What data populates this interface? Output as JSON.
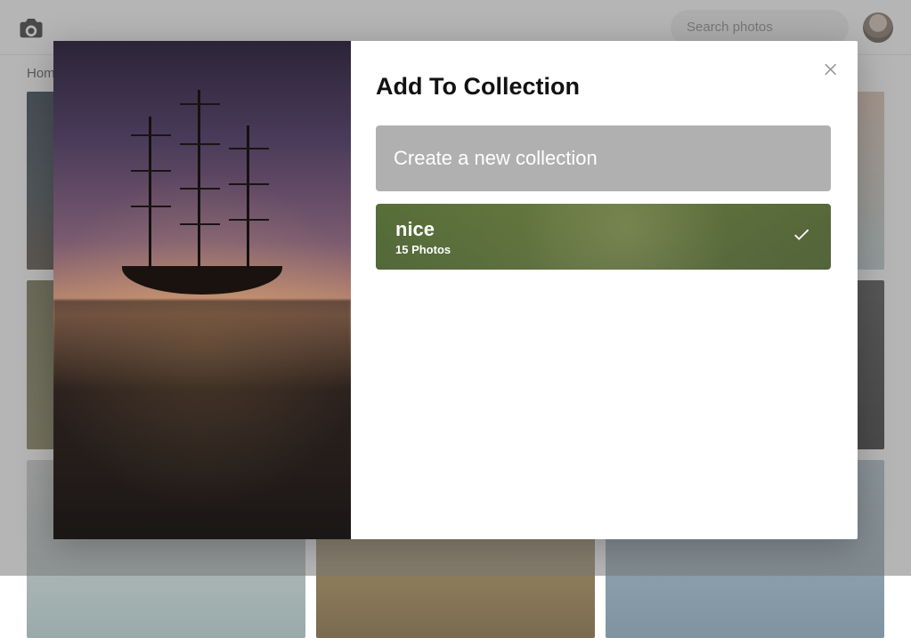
{
  "header": {
    "search_placeholder": "Search photos"
  },
  "breadcrumb": {
    "home": "Home"
  },
  "modal": {
    "title": "Add To Collection",
    "create_label": "Create a new collection",
    "collections": [
      {
        "name": "nice",
        "count_label": "15 Photos",
        "selected": true
      }
    ]
  }
}
